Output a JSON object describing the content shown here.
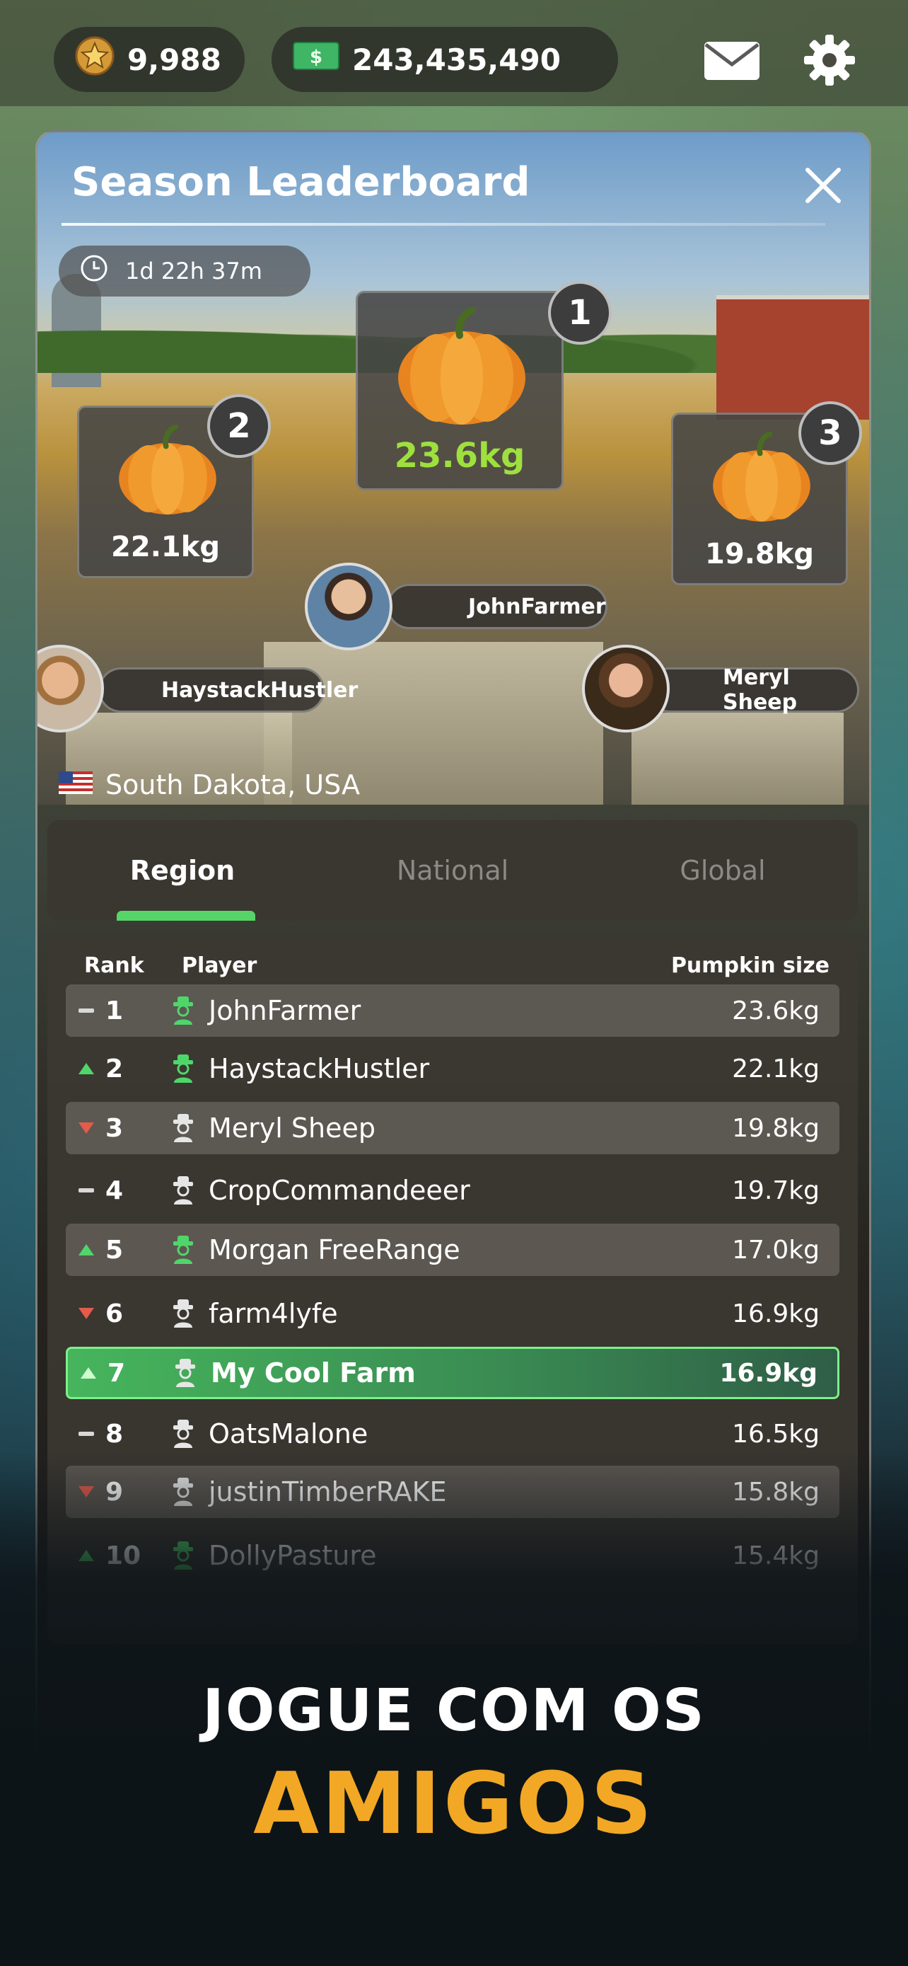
{
  "hud": {
    "coins": "9,988",
    "cash": "243,435,490"
  },
  "panel": {
    "title": "Season Leaderboard",
    "timer": "1d 22h 37m",
    "location": "South Dakota, USA"
  },
  "podium": [
    {
      "rank": "1",
      "weight": "23.6kg",
      "player": "JohnFarmer"
    },
    {
      "rank": "2",
      "weight": "22.1kg",
      "player": "HaystackHustler"
    },
    {
      "rank": "3",
      "weight": "19.8kg",
      "player": "Meryl Sheep"
    }
  ],
  "tabs": [
    {
      "label": "Region",
      "active": true
    },
    {
      "label": "National",
      "active": false
    },
    {
      "label": "Global",
      "active": false
    }
  ],
  "table": {
    "headers": {
      "rank": "Rank",
      "player": "Player",
      "size": "Pumpkin size"
    },
    "rows": [
      {
        "rank": "1",
        "trend": "same",
        "player": "JohnFarmer",
        "size": "23.6kg",
        "friend": true
      },
      {
        "rank": "2",
        "trend": "up",
        "player": "HaystackHustler",
        "size": "22.1kg",
        "friend": true
      },
      {
        "rank": "3",
        "trend": "down",
        "player": "Meryl Sheep",
        "size": "19.8kg",
        "friend": false
      },
      {
        "rank": "4",
        "trend": "same",
        "player": "CropCommandeeer",
        "size": "19.7kg",
        "friend": false
      },
      {
        "rank": "5",
        "trend": "up",
        "player": "Morgan FreeRange",
        "size": "17.0kg",
        "friend": true
      },
      {
        "rank": "6",
        "trend": "down",
        "player": "farm4lyfe",
        "size": "16.9kg",
        "friend": false
      },
      {
        "rank": "7",
        "trend": "up",
        "player": "My Cool Farm",
        "size": "16.9kg",
        "friend": false
      },
      {
        "rank": "8",
        "trend": "same",
        "player": "OatsMalone",
        "size": "16.5kg",
        "friend": false
      },
      {
        "rank": "9",
        "trend": "down",
        "player": "justinTimberRAKE",
        "size": "15.8kg",
        "friend": false
      },
      {
        "rank": "10",
        "trend": "up",
        "player": "DollyPasture",
        "size": "15.4kg",
        "friend": true
      }
    ]
  },
  "promo": {
    "line1": "JOGUE COM OS",
    "line2": "AMIGOS"
  },
  "colors": {
    "accent_green": "#57d468",
    "promo_orange": "#f2a825",
    "trend_up": "#4fd66a",
    "trend_down": "#e35b4b"
  },
  "icons": {
    "coin": "star-coin-icon",
    "cash": "dollar-bill-icon",
    "mail": "mail-icon",
    "settings": "gear-icon",
    "close": "close-icon",
    "timer": "clock-icon",
    "flag": "us-flag-icon",
    "farmer": "farmer-icon"
  }
}
